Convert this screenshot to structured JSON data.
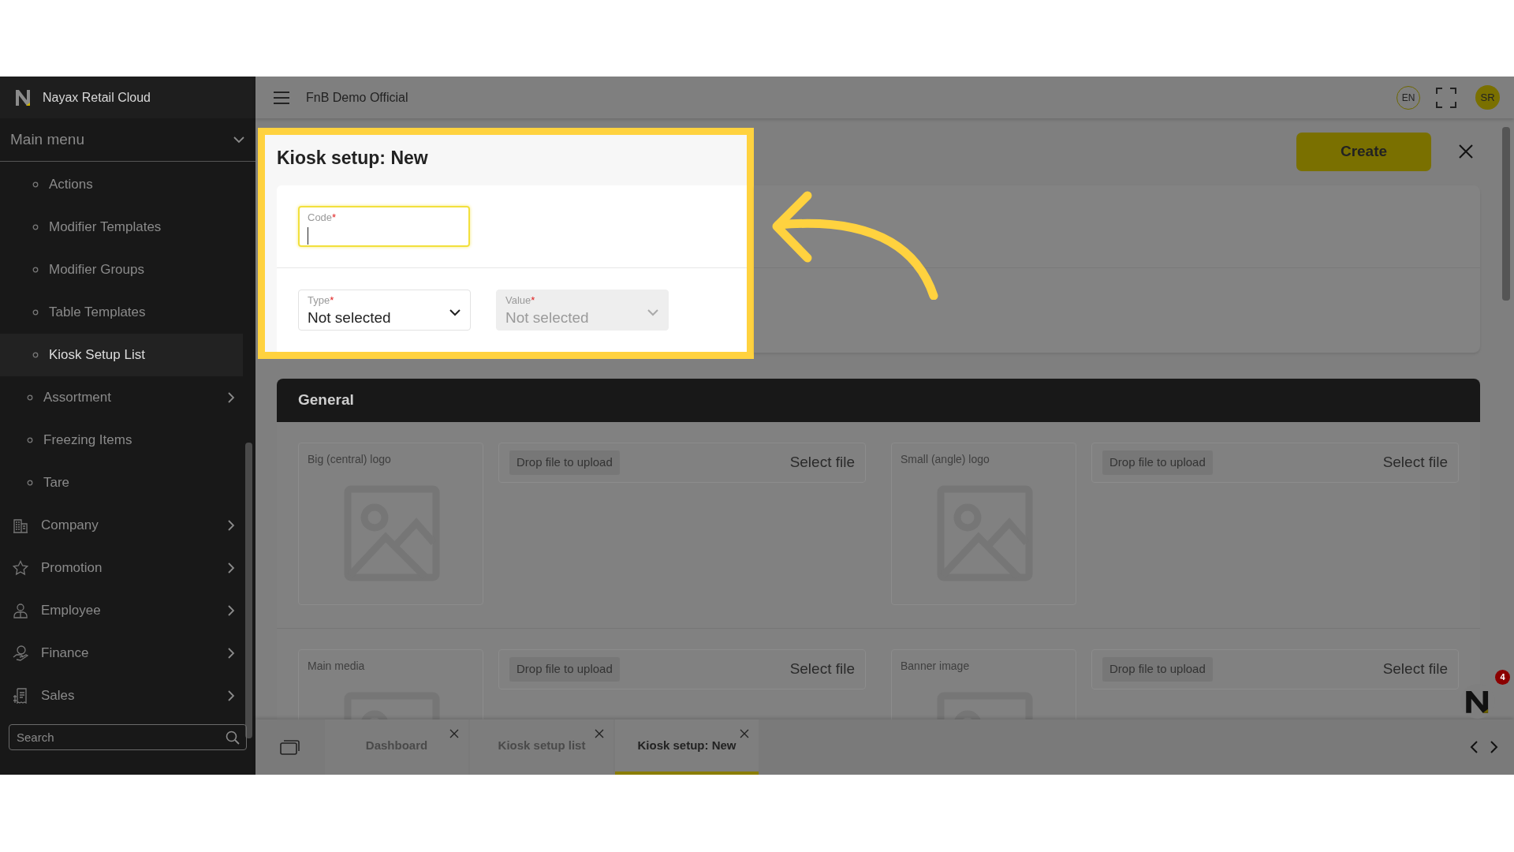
{
  "app": {
    "name": "Nayax Retail Cloud"
  },
  "sidebar": {
    "menu_title": "Main menu",
    "expanded": true,
    "submenu": [
      {
        "label": "Actions",
        "selected": false
      },
      {
        "label": "Modifier Templates",
        "selected": false
      },
      {
        "label": "Modifier Groups",
        "selected": false
      },
      {
        "label": "Table Templates",
        "selected": false
      },
      {
        "label": "Kiosk Setup List",
        "selected": true
      }
    ],
    "items": [
      {
        "kind": "bullet",
        "label": "Assortment",
        "has_children": true
      },
      {
        "kind": "bullet",
        "label": "Freezing Items",
        "has_children": false
      },
      {
        "kind": "bullet",
        "label": "Tare",
        "has_children": false
      },
      {
        "kind": "module",
        "label": "Company",
        "has_children": true
      },
      {
        "kind": "module",
        "label": "Promotion",
        "has_children": true
      },
      {
        "kind": "module",
        "label": "Employee",
        "has_children": true
      },
      {
        "kind": "module",
        "label": "Finance",
        "has_children": true
      },
      {
        "kind": "module",
        "label": "Sales",
        "has_children": true
      }
    ],
    "search": {
      "placeholder": "Search"
    }
  },
  "topbar": {
    "title": "FnB Demo Official",
    "language": "EN",
    "user_initials": "SR"
  },
  "form": {
    "title": "Kiosk setup: New",
    "create_button": "Create",
    "fields": [
      {
        "kind": "text",
        "label": "Code",
        "required_mark": "*",
        "focused": true
      },
      {
        "kind": "select",
        "label": "Type",
        "required_mark": "*",
        "value": "Not selected",
        "disabled": false
      },
      {
        "kind": "select",
        "label": "Value",
        "required_mark": "*",
        "value": "Not selected",
        "disabled": true
      }
    ]
  },
  "general": {
    "title": "General",
    "uploads": [
      {
        "label": "Big (central) logo",
        "drop_hint": "Drop file to upload",
        "button": "Select file"
      },
      {
        "label": "Small (angle) logo",
        "drop_hint": "Drop file to upload",
        "button": "Select file"
      },
      {
        "label": "Main media",
        "drop_hint": "Drop file to upload",
        "button": "Select file"
      },
      {
        "label": "Banner image",
        "drop_hint": "Drop file to upload",
        "button": "Select file"
      }
    ]
  },
  "tabs": [
    {
      "label": "Dashboard",
      "selected": false
    },
    {
      "label": "Kiosk setup list",
      "selected": false
    },
    {
      "label": "Kiosk setup: New",
      "selected": true
    }
  ],
  "assistant": {
    "badge": "4"
  }
}
